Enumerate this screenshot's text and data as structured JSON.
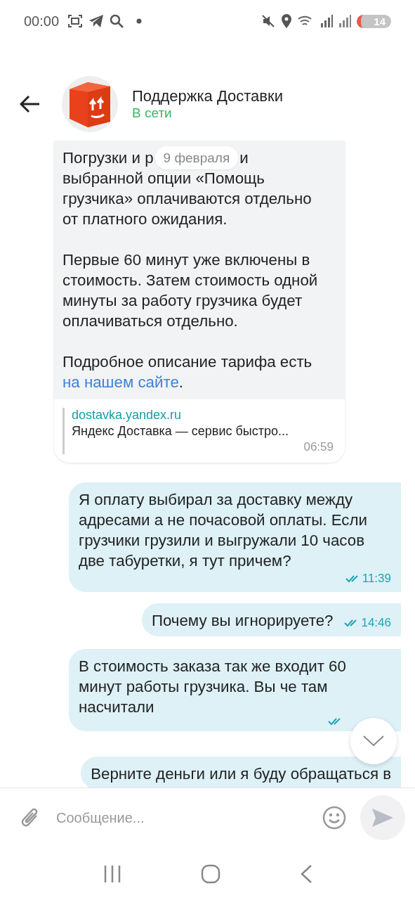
{
  "status_bar": {
    "time": "00:00",
    "battery": "14"
  },
  "header": {
    "title": "Поддержка Доставки",
    "status": "В сети"
  },
  "date_pill": "9 февраля",
  "incoming": {
    "first_line": [
      "Погрузки и р",
      "и"
    ],
    "paragraphs": [
      "выбранной опции «Помощь грузчика» оплачиваются отдельно от платного ожидания.",
      "Первые 60 минут уже включены в стоимость. Затем стоимость одной минуты за работу грузчика будет оплачиваться отдельно."
    ],
    "last_text": "Подробное описание тарифа есть ",
    "link": "на нашем сайте",
    "after_link": ".",
    "preview": {
      "domain": "dostavka.yandex.ru",
      "title": "Яндекс Доставка — сервис быстро..."
    },
    "time": "06:59"
  },
  "outgoing": [
    {
      "text": "Я оплату выбирал за доставку между адресами а не почасовой оплаты. Если грузчики грузили и выгружали 10 часов две табуретки, я тут причем?",
      "time": "11:39",
      "read": true
    },
    {
      "text": "Почему вы игнорируете?",
      "time": "14:46",
      "read": true
    },
    {
      "text": "В стоимость заказа так же входит 60 минут работы грузчика. Вы че там насчитали",
      "read": true
    },
    {
      "text": "Верните деньги или я буду обращаться в"
    }
  ],
  "composer": {
    "placeholder": "Сообщение..."
  }
}
